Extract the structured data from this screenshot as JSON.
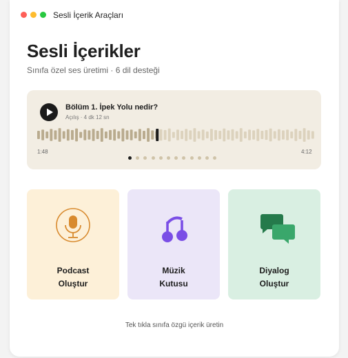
{
  "window": {
    "title": "Sesli İçerik Araçları"
  },
  "header": {
    "title": "Sesli İçerikler",
    "subtitle": "Sınıfa özel ses üretimi · 6 dil desteği"
  },
  "player": {
    "episode_title": "Bölüm 1. İpek Yolu nedir?",
    "episode_meta": "Açılış · 4 dk 12 sn",
    "time_start": "1:48",
    "time_end": "4:12",
    "progress": 0.43,
    "waveform_heights": [
      0.55,
      0.7,
      0.45,
      0.8,
      0.6,
      0.9,
      0.5,
      0.75,
      0.65,
      0.85,
      0.4,
      0.7,
      0.6,
      0.8,
      0.55,
      0.9,
      0.45,
      0.65,
      0.75,
      0.5,
      0.85,
      0.6,
      0.7,
      0.45,
      0.8,
      0.55,
      0.9,
      0.6,
      0.5,
      0.75,
      0.65,
      0.85,
      0.4,
      0.7,
      0.55,
      0.8,
      0.6,
      0.9,
      0.5,
      0.7,
      0.45,
      0.8,
      0.65,
      0.55,
      0.85,
      0.6,
      0.75,
      0.5,
      0.9,
      0.45,
      0.7,
      0.6,
      0.8,
      0.55,
      0.65,
      0.85,
      0.5,
      0.75,
      0.6,
      0.7,
      0.45,
      0.8,
      0.55,
      0.9,
      0.6,
      0.5
    ],
    "page_count": 12,
    "active_page": 0,
    "colors": {
      "played": "#b9ab8e",
      "unplayed": "#dcd2bd",
      "playhead": "#1c1c1c"
    }
  },
  "cards": [
    {
      "id": "podcast",
      "line1": "Podcast",
      "line2": "Oluştur",
      "icon": "microphone-icon",
      "accent": "#d88a2e"
    },
    {
      "id": "music",
      "line1": "Müzik",
      "line2": "Kutusu",
      "icon": "music-note-icon",
      "accent": "#7a4ee6"
    },
    {
      "id": "dialog",
      "line1": "Diyalog",
      "line2": "Oluştur",
      "icon": "chat-bubbles-icon",
      "accent": "#2e8a5a"
    }
  ],
  "footer": {
    "note": "Tek tıkla sınıfa özgü içerik üretin"
  }
}
